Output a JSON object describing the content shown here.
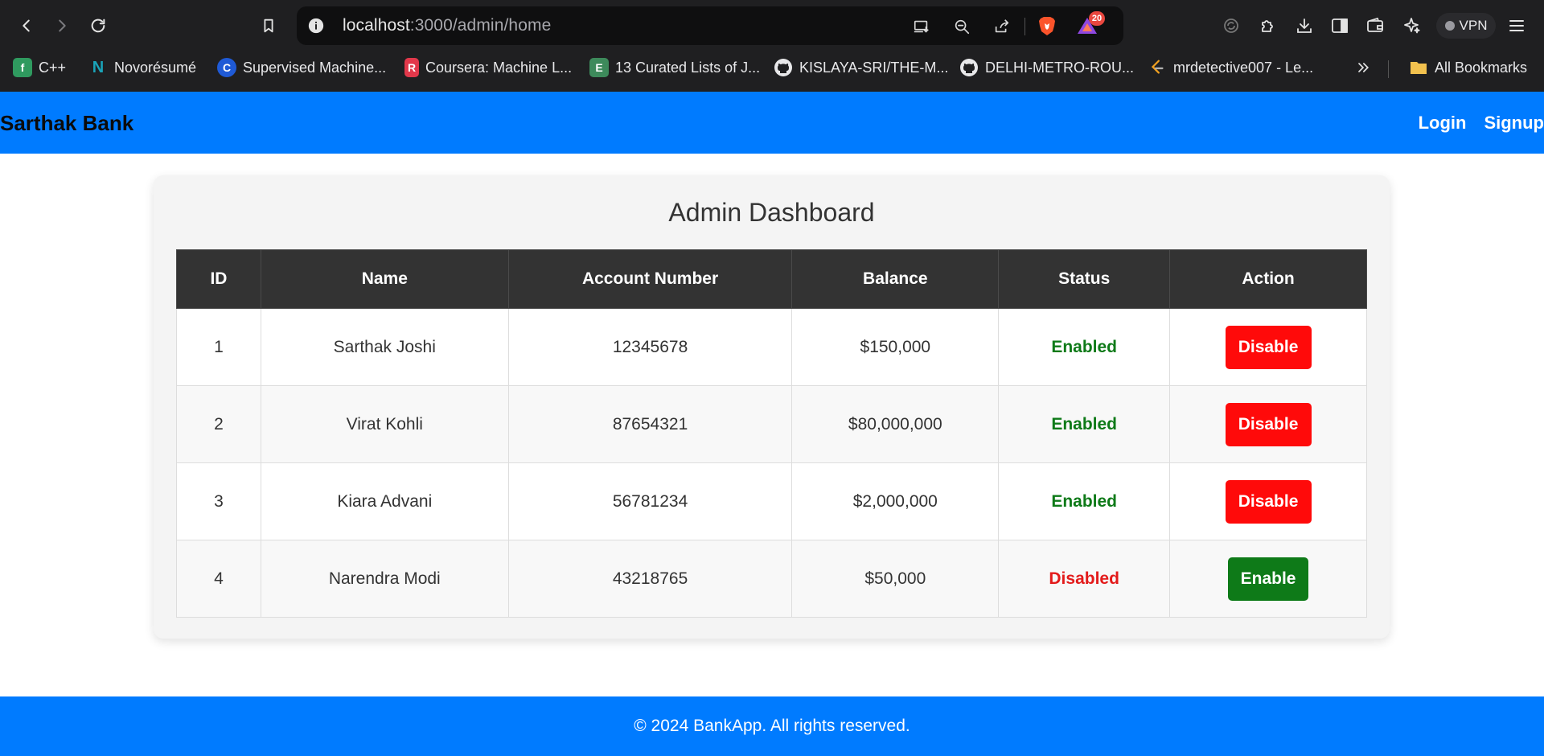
{
  "browser": {
    "url_host": "localhost",
    "url_path": ":3000/admin/home",
    "rewards_badge": "20",
    "vpn_label": "VPN"
  },
  "bookmarks": [
    {
      "label": "C++",
      "icon": "f",
      "color": "#2f9a5f"
    },
    {
      "label": "Novorésumé",
      "icon": "N",
      "color": "#1aa3b8"
    },
    {
      "label": "Supervised Machine...",
      "icon": "C",
      "color": "#1f5ad6"
    },
    {
      "label": "Coursera: Machine L...",
      "icon": "R",
      "color": "#e2384b"
    },
    {
      "label": "13 Curated Lists of J...",
      "icon": "E",
      "color": "#3d8a5b"
    },
    {
      "label": "KISLAYA-SRI/THE-M...",
      "icon": "gh",
      "color": "#1f1f21"
    },
    {
      "label": "DELHI-METRO-ROU...",
      "icon": "gh",
      "color": "#1f1f21"
    },
    {
      "label": "mrdetective007 - Le...",
      "icon": "lc",
      "color": "#1f1f21"
    }
  ],
  "bookmarks_all": "All Bookmarks",
  "navbar": {
    "brand": "Sarthak Bank",
    "login": "Login",
    "signup": "Signup"
  },
  "dashboard": {
    "title": "Admin Dashboard",
    "columns": [
      "ID",
      "Name",
      "Account Number",
      "Balance",
      "Status",
      "Action"
    ],
    "rows": [
      {
        "id": "1",
        "name": "Sarthak Joshi",
        "account": "12345678",
        "balance": "$150,000",
        "status": "Enabled",
        "action": "Disable"
      },
      {
        "id": "2",
        "name": "Virat Kohli",
        "account": "87654321",
        "balance": "$80,000,000",
        "status": "Enabled",
        "action": "Disable"
      },
      {
        "id": "3",
        "name": "Kiara Advani",
        "account": "56781234",
        "balance": "$2,000,000",
        "status": "Enabled",
        "action": "Disable"
      },
      {
        "id": "4",
        "name": "Narendra Modi",
        "account": "43218765",
        "balance": "$50,000",
        "status": "Disabled",
        "action": "Enable"
      }
    ]
  },
  "footer": {
    "text": "© 2024 BankApp. All rights reserved."
  },
  "colors": {
    "primary": "#007bff",
    "header_dark": "#333333",
    "enabled": "#0e7a18",
    "disabled": "#e31b1b",
    "danger_button": "#ff0a0a"
  }
}
